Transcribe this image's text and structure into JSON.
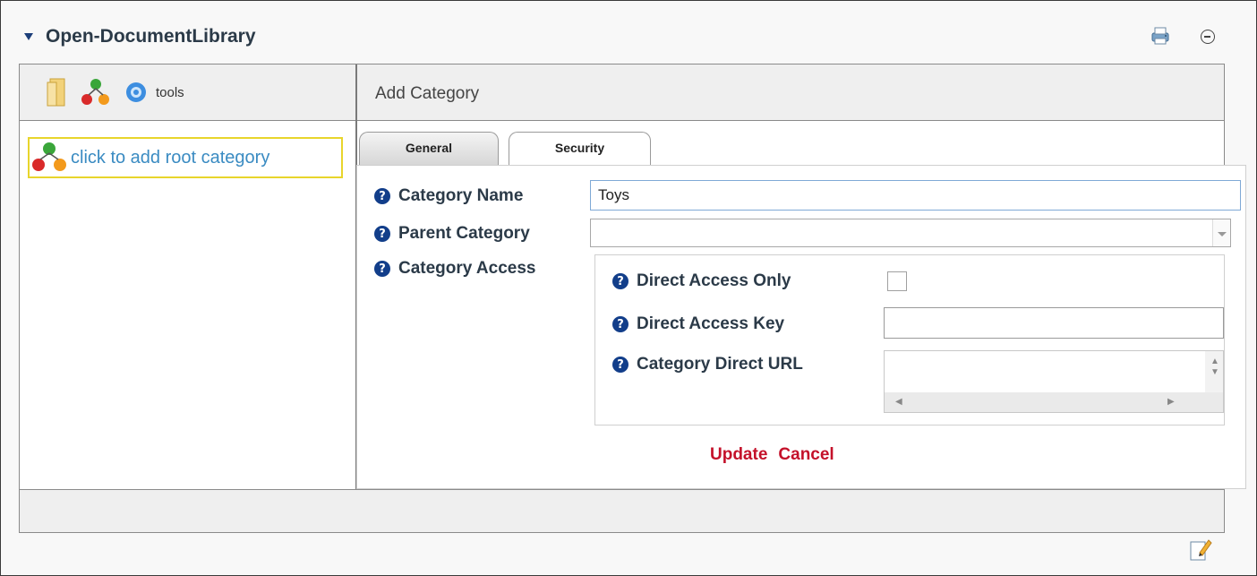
{
  "module": {
    "title": "Open-DocumentLibrary",
    "icons": [
      "expand-triangle-icon",
      "print-icon",
      "minimize-icon"
    ]
  },
  "toolbar": {
    "tools_label": "tools",
    "icons": [
      "folder-icon",
      "category-icon",
      "gear-icon"
    ]
  },
  "panel": {
    "title": "Add Category"
  },
  "tree": {
    "root_label": "click to add root category"
  },
  "tabs": [
    {
      "label": "General",
      "active": true
    },
    {
      "label": "Security",
      "active": false
    }
  ],
  "form": {
    "category_name_label": "Category Name",
    "category_name_value": "Toys",
    "parent_category_label": "Parent Category",
    "parent_category_value": "",
    "category_access_label": "Category Access",
    "direct_access_only_label": "Direct Access Only",
    "direct_access_only_checked": false,
    "direct_access_key_label": "Direct Access Key",
    "direct_access_key_value": "",
    "category_direct_url_label": "Category Direct URL",
    "category_direct_url_value": ""
  },
  "actions": {
    "update": "Update",
    "cancel": "Cancel"
  },
  "colors": {
    "title_text": "#2b3a48",
    "link": "#3a8bc2",
    "action": "#c4112a",
    "help_icon": "#123e8a",
    "root_highlight": "#e8d52c"
  }
}
